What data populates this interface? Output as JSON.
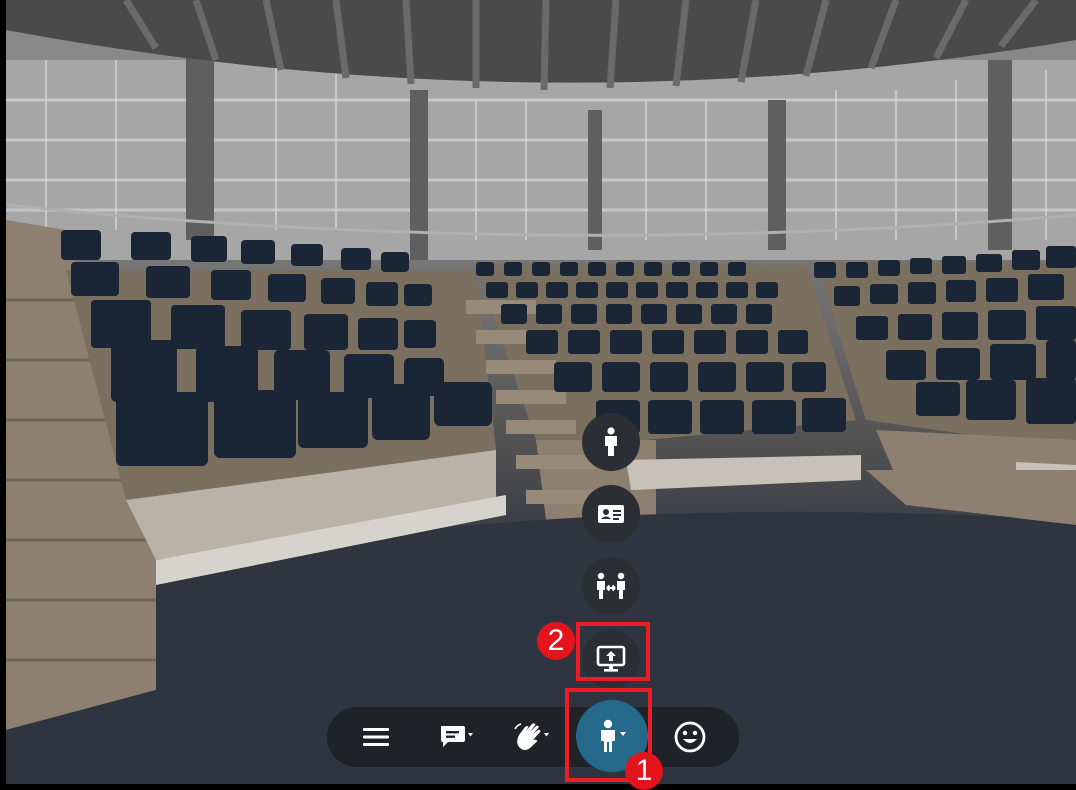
{
  "scene": {
    "description_colors": {
      "seat": "#1a2535",
      "marble": "#8f826f",
      "floor": "#2c3139"
    }
  },
  "dock": {
    "items": [
      {
        "name": "avatar-action",
        "icon": "person-standing-icon"
      },
      {
        "name": "contact-card-action",
        "icon": "contact-card-icon"
      },
      {
        "name": "meet-action",
        "icon": "two-people-exchange-icon"
      },
      {
        "name": "share-screen-action",
        "icon": "monitor-upload-icon"
      }
    ]
  },
  "toolbar": {
    "items": [
      {
        "name": "menu",
        "icon": "hamburger-menu-icon"
      },
      {
        "name": "chat",
        "icon": "chat-bubble-icon"
      },
      {
        "name": "wave",
        "icon": "waving-hand-icon"
      },
      {
        "name": "avatar",
        "icon": "person-icon",
        "active": true
      },
      {
        "name": "emoji",
        "icon": "smiley-face-icon"
      }
    ],
    "accent_color": "#256a8a"
  },
  "annotations": {
    "badge1": "1",
    "badge2": "2",
    "color": "#ee1c25"
  }
}
